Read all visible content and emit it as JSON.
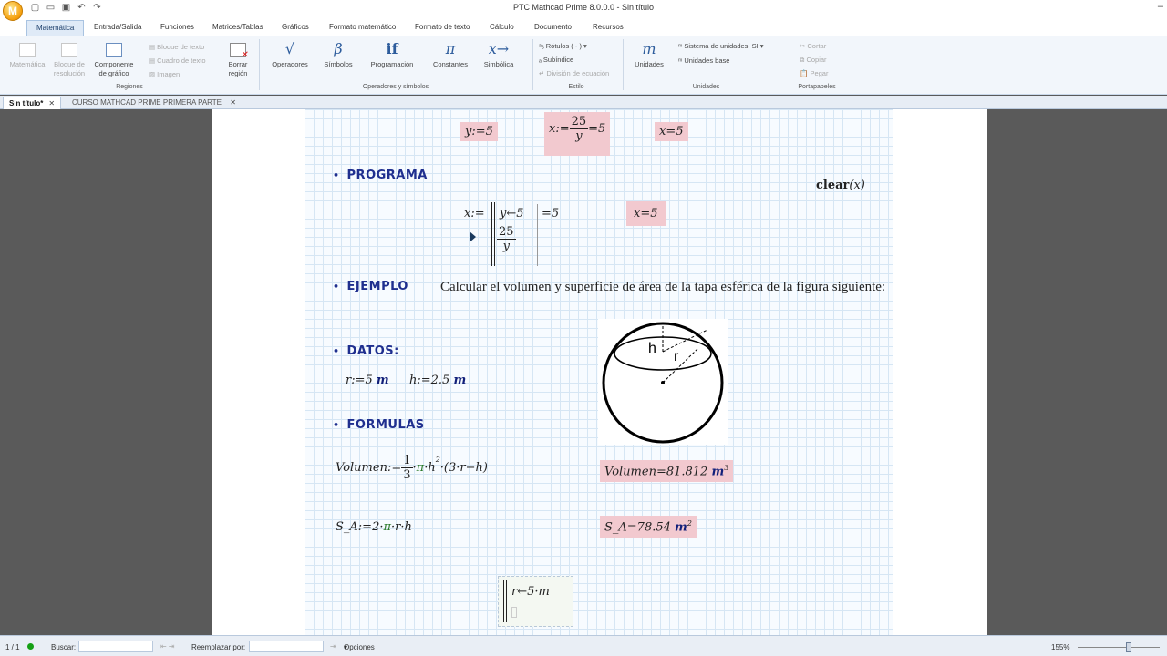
{
  "window": {
    "title": "PTC Mathcad Prime 8.0.0.0 - Sin título",
    "logo_letter": "M"
  },
  "ribbon_tabs": [
    "Matemática",
    "Entrada/Salida",
    "Funciones",
    "Matrices/Tablas",
    "Gráficos",
    "Formato matemático",
    "Formato de texto",
    "Cálculo",
    "Documento",
    "Recursos"
  ],
  "ribbon": {
    "regions": {
      "matematica": "Matemática",
      "bloque_resolucion": "Bloque de resolución",
      "componente_grafico": "Componente de gráfico",
      "bloque_texto": "Bloque de texto",
      "cuadro_texto": "Cuadro de texto",
      "imagen": "Imagen",
      "borrar_region": "Borrar región",
      "group_label": "Regiones"
    },
    "operators": {
      "operadores": "Operadores",
      "simbolos": "Símbolos",
      "programacion": "Programación",
      "constantes": "Constantes",
      "simbolica": "Simbólica",
      "group_label": "Operadores y símbolos",
      "icons": {
        "operadores": "√",
        "simbolos": "β",
        "programacion": "if",
        "constantes": "π",
        "simbolica": "x→"
      }
    },
    "style": {
      "rotulos": "Rótulos",
      "rotulos_value": "( - )",
      "subindice": "Subíndice",
      "division": "División de ecuación",
      "group_label": "Estilo"
    },
    "units": {
      "unidades": "Unidades",
      "unidades_icon": "m",
      "sistema": "Sistema de unidades:",
      "sistema_value": "SI",
      "base": "Unidades base",
      "group_label": "Unidades"
    },
    "clipboard": {
      "cortar": "Cortar",
      "copiar": "Copiar",
      "pegar": "Pegar",
      "group_label": "Portapapeles"
    }
  },
  "doc_tabs": [
    {
      "label": "Sin título*",
      "close": "✕"
    },
    {
      "label": "CURSO MATHCAD PRIME PRIMERA PARTE",
      "close": "✕"
    }
  ],
  "worksheet": {
    "row1": {
      "y_def": "y:=5",
      "x_def_lhs": "x:=",
      "x_def_num": "25",
      "x_def_den": "y",
      "x_def_eq": "=5",
      "x_res": "x=5"
    },
    "heading_programa": "PROGRAMA",
    "clear": {
      "fn": "clear",
      "arg": "(x)"
    },
    "program": {
      "lhs": "x:=",
      "line1": "y←5",
      "num": "25",
      "den": "y",
      "result_inline": "=5",
      "result": "x=5"
    },
    "heading_ejemplo": "EJEMPLO",
    "ejemplo_text": "Calcular el volumen y superficie de área de la tapa esférica de la figura siguiente:",
    "figure_labels": {
      "h": "h",
      "r": "r"
    },
    "heading_datos": "DATOS:",
    "datos": {
      "r_def": "r:=5",
      "r_unit": "m",
      "h_def": "h:=2.5",
      "h_unit": "m"
    },
    "heading_formulas": "FORMULAS",
    "volumen": {
      "lhs": "Volumen:=",
      "num": "1",
      "den": "3",
      "pi": "π",
      "rest_a": "·h",
      "exp": "2",
      "rest_b": "·(3·r−h)",
      "result": "Volumen=81.812",
      "result_unit": "m",
      "result_exp": "3"
    },
    "sa": {
      "lhs": "S_A:=2·",
      "pi": "π",
      "rest": "·r·h",
      "result": "S_A=78.54",
      "result_unit": "m",
      "result_exp": "2"
    },
    "bottom_program": {
      "line1": "r←5·m"
    }
  },
  "statusbar": {
    "page": "1 / 1",
    "buscar": "Buscar:",
    "reemplazar": "Reemplazar por:",
    "opciones": "Opciones",
    "zoom": "155%"
  }
}
